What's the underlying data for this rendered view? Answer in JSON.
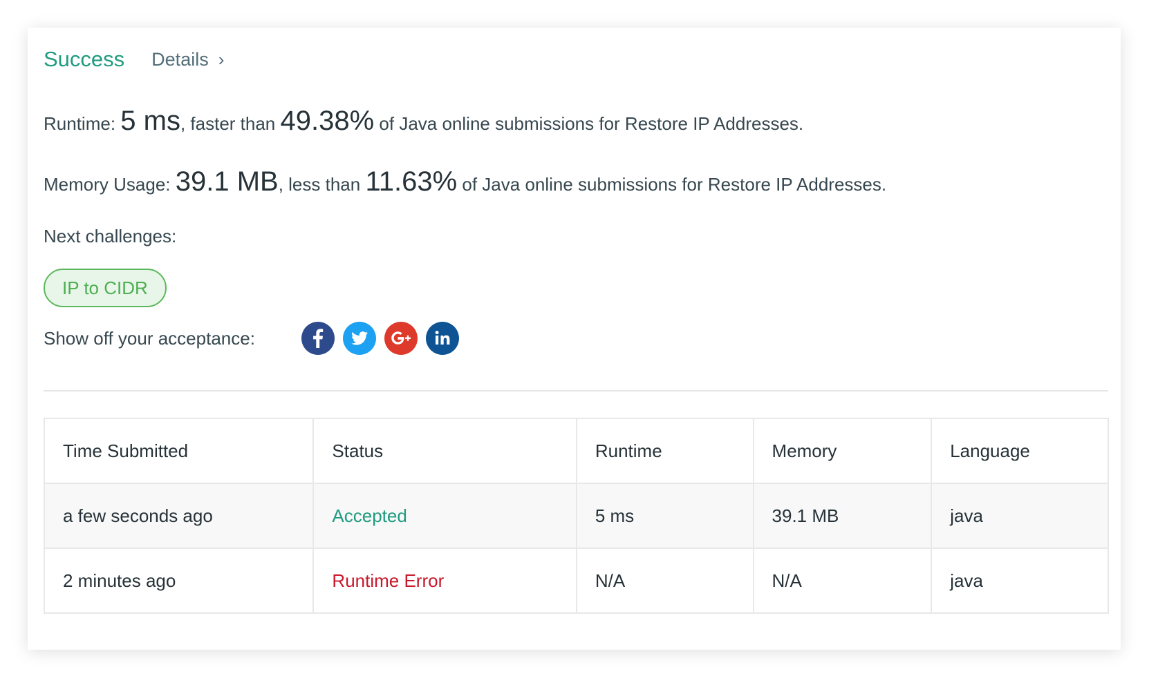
{
  "header": {
    "status": "Success",
    "details_label": "Details",
    "details_chevron": "›"
  },
  "runtime": {
    "label": "Runtime:",
    "value": "5 ms",
    "comparison": ", faster than",
    "percent": "49.38%",
    "suffix": "of Java online submissions for Restore IP Addresses."
  },
  "memory": {
    "label": "Memory Usage:",
    "value": "39.1 MB",
    "comparison": ", less than",
    "percent": "11.63%",
    "suffix": "of Java online submissions for Restore IP Addresses."
  },
  "next": {
    "label": "Next challenges:",
    "challenges": [
      "IP to CIDR"
    ]
  },
  "share": {
    "label": "Show off your acceptance:",
    "icons": [
      "facebook-icon",
      "twitter-icon",
      "google-plus-icon",
      "linkedin-icon"
    ],
    "colors": {
      "facebook": "#2c4a8c",
      "twitter": "#1da1f2",
      "google_plus": "#dd3a2c",
      "linkedin": "#0e5394"
    }
  },
  "table": {
    "headers": [
      "Time Submitted",
      "Status",
      "Runtime",
      "Memory",
      "Language"
    ],
    "rows": [
      [
        "a few seconds ago",
        "Accepted",
        "5 ms",
        "39.1 MB",
        "java"
      ],
      [
        "2 minutes ago",
        "Runtime Error",
        "N/A",
        "N/A",
        "java"
      ]
    ]
  },
  "colors": {
    "success": "#1f9b7f",
    "error": "#c9182b",
    "tag_border": "#5cb85c",
    "tag_text": "#4caf50"
  }
}
